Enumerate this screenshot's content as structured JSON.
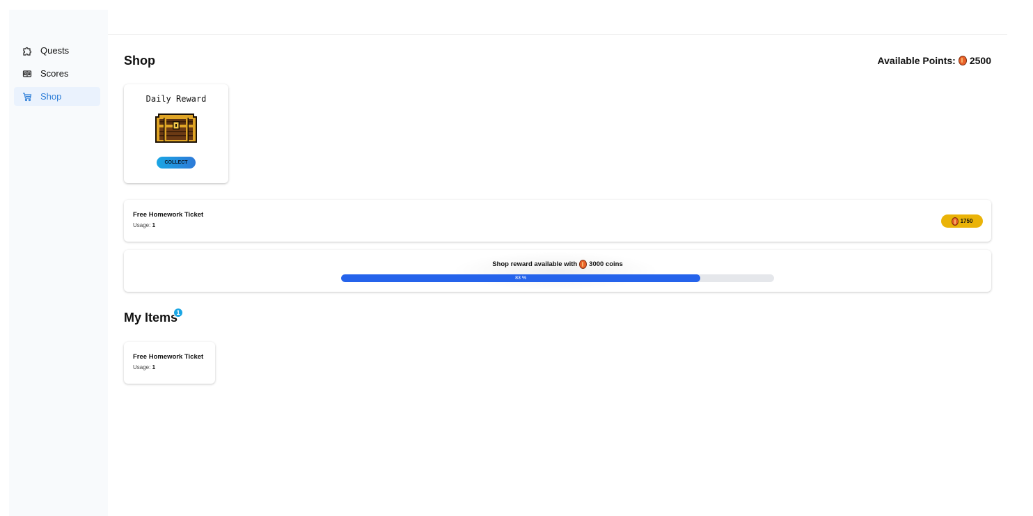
{
  "sidebar": {
    "items": [
      {
        "label": "Quests",
        "icon": "puzzle-icon"
      },
      {
        "label": "Scores",
        "icon": "scoreboard-icon"
      },
      {
        "label": "Shop",
        "icon": "cart-icon",
        "active": true
      }
    ]
  },
  "header": {
    "title": "Shop",
    "points_label": "Available Points:",
    "points_value": "2500"
  },
  "daily_reward": {
    "title": "Daily Reward",
    "icon": "treasure-chest-icon",
    "button_label": "COLLECT"
  },
  "shop_items": [
    {
      "name": "Free Homework Ticket",
      "usage_label": "Usage:",
      "usage_value": "1",
      "price": "1750"
    }
  ],
  "reward_progress": {
    "label_prefix": "Shop reward available with",
    "label_amount": "3000 coins",
    "percent_text": "83 %",
    "fraction": 0.83
  },
  "my_items": {
    "title": "My Items",
    "badge_count": "1",
    "items": [
      {
        "name": "Free Homework Ticket",
        "usage_label": "Usage:",
        "usage_value": "1"
      }
    ]
  },
  "colors": {
    "accent": "#2f7fd8",
    "progress": "#2563eb",
    "price": "#eab308",
    "coin": "#e9622a",
    "badge": "#1aa6e4"
  }
}
